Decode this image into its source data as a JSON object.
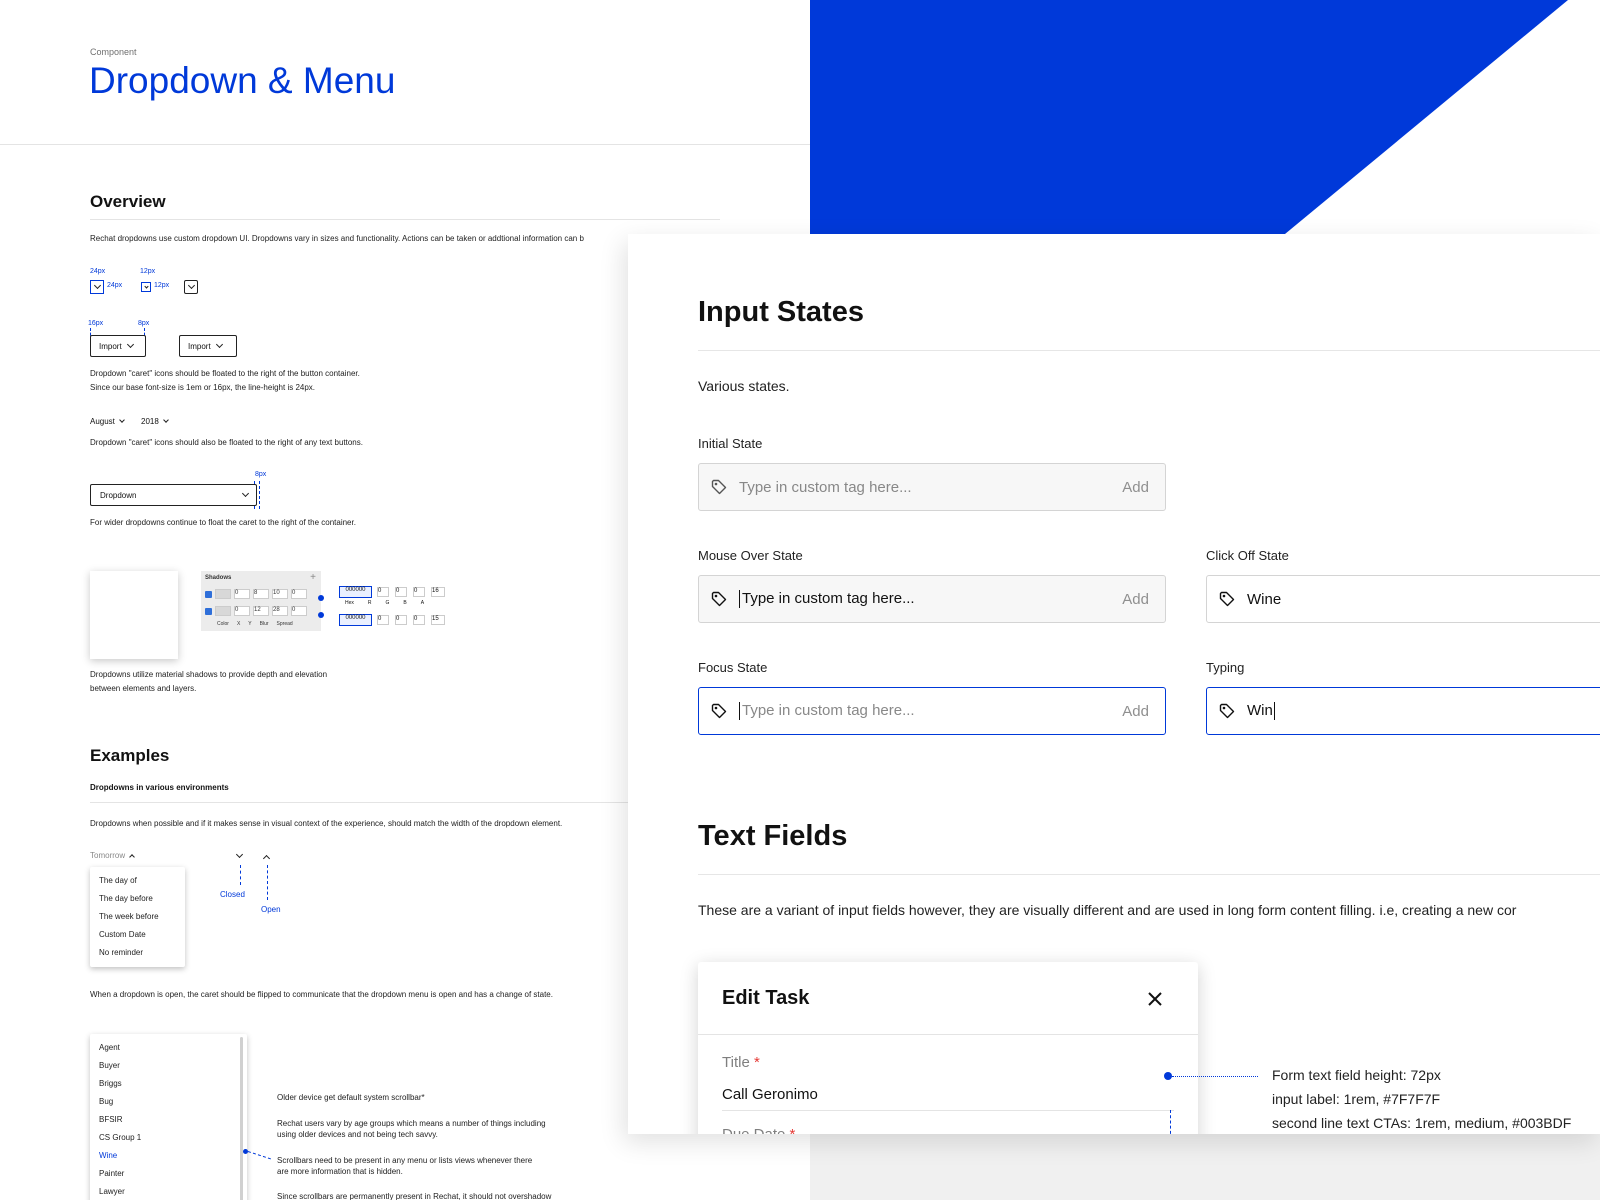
{
  "left_doc": {
    "kicker": "Component",
    "title": "Dropdown & Menu",
    "overview": {
      "heading": "Overview",
      "intro": "Rechat dropdowns use custom dropdown UI. Dropdowns vary in sizes and functionality. Actions can be taken or addtional information can b",
      "size_specs": [
        "24px",
        "24px",
        "12px",
        "12px"
      ],
      "padding_specs": [
        "16px",
        "8px"
      ],
      "import_label": "Import",
      "caret_note_1": "Dropdown \"caret\" icons should be floated to the right of the button container.",
      "caret_note_2": "Since our base font-size is 1em or 16px, the line-height is 24px.",
      "month_label": "August",
      "year_label": "2018",
      "text_button_note": "Dropdown \"caret\" icons should also be floated to the right of any text buttons.",
      "wide_spec": "8px",
      "wide_dropdown_label": "Dropdown",
      "wide_note": "For wider dropdowns continue to float the caret to the right of the container.",
      "shadows": {
        "title": "Shadows",
        "add": "+",
        "row1": [
          "0",
          "8",
          "10",
          "0"
        ],
        "row2": [
          "0",
          "12",
          "28",
          "0"
        ],
        "cols": [
          "Color",
          "X",
          "Y",
          "Blur",
          "Spread"
        ],
        "hex1": "000000",
        "hex2": "000000",
        "rgba1": [
          "0",
          "0",
          "0",
          "16"
        ],
        "rgba2": [
          "0",
          "0",
          "0",
          "15"
        ],
        "rgba_cols": [
          "Hex",
          "R",
          "G",
          "B",
          "A"
        ]
      },
      "shadow_note_1": "Dropdowns utilize material shadows to provide depth and elevation",
      "shadow_note_2": "between elements and layers."
    },
    "examples": {
      "heading": "Examples",
      "subheading": "Dropdowns in various environments",
      "match_note": "Dropdowns when possible and if it makes sense in visual context of the experience, should match the width of the dropdown element.",
      "trigger_label": "Tomorrow",
      "menu_items": [
        "The day of",
        "The day before",
        "The week before",
        "Custom Date",
        "No reminder"
      ],
      "closed_label": "Closed",
      "open_label": "Open",
      "open_note": "When a dropdown is open, the caret should be flipped to communicate that the dropdown menu is open and has a change of state.",
      "list_items": [
        "Agent",
        "Buyer",
        "Briggs",
        "Bug",
        "BFSIR",
        "CS Group 1",
        "Wine",
        "Painter",
        "Lawyer"
      ],
      "selected_item": "Wine",
      "scroll_note_1": "Older device get default system scrollbar*",
      "scroll_note_2a": "Rechat users vary by age groups which means a number of things including",
      "scroll_note_2b": "using older devices and not being tech savvy.",
      "scroll_note_3a": "Scrollbars need to be present in any menu or lists views whenever there",
      "scroll_note_3b": "are more information that is hidden.",
      "scroll_note_4": "Since scrollbars are permanently present in Rechat, it should not overshadow"
    }
  },
  "right_doc": {
    "input_states": {
      "heading": "Input  States",
      "intro": "Various states.",
      "placeholder": "Type in custom tag here...",
      "add_label": "Add",
      "initial_label": "Initial State",
      "mouse_over_label": "Mouse Over State",
      "click_off_label": "Click Off State",
      "click_off_value": "Wine",
      "focus_label": "Focus State",
      "typing_label": "Typing",
      "typing_value": "Win"
    },
    "text_fields": {
      "heading": "Text Fields",
      "intro": "These are a variant of input fields however, they are visually different and are used in long form content filling. i.e, creating a new cor",
      "modal": {
        "title": "Edit Task",
        "title_label": "Title",
        "title_value": "Call Geronimo",
        "due_label": "Due Date",
        "required_mark": "*"
      },
      "notes": [
        "Form text field height: 72px",
        "input label: 1rem, #7F7F7F",
        "second line text CTAs: 1rem, medium, #003BDF"
      ]
    }
  },
  "colors": {
    "brand_blue": "#0039d9",
    "label_grey": "#7F7F7F",
    "required_red": "#e53935"
  }
}
